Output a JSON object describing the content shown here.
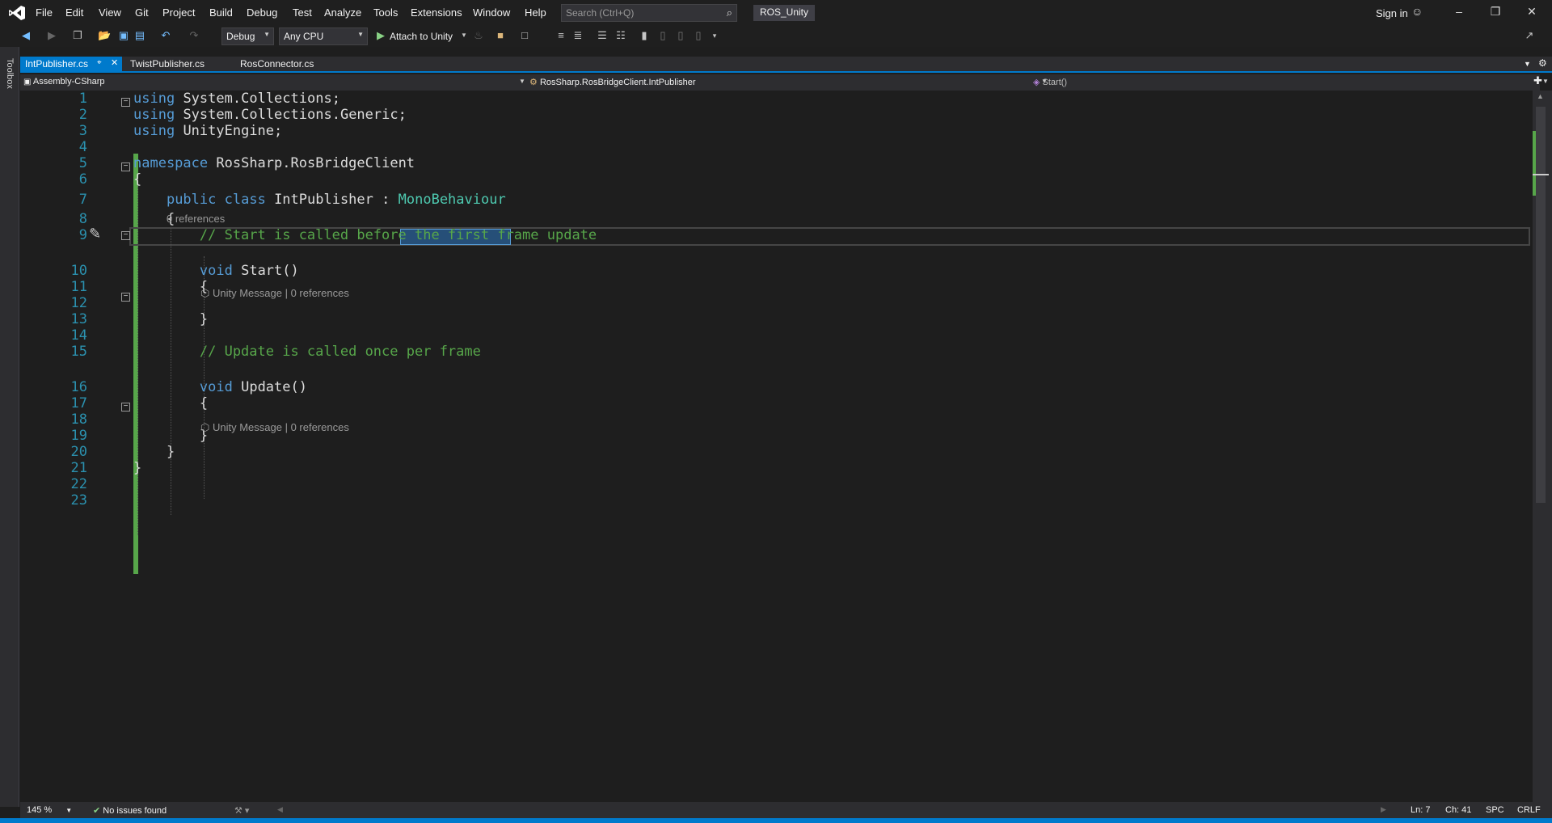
{
  "menu": [
    "File",
    "Edit",
    "View",
    "Git",
    "Project",
    "Build",
    "Debug",
    "Test",
    "Analyze",
    "Tools",
    "Extensions",
    "Window",
    "Help"
  ],
  "search": {
    "placeholder": "Search (Ctrl+Q)"
  },
  "solution_name": "ROS_Unity",
  "sign_in": "Sign in",
  "toolbar": {
    "config": "Debug",
    "platform": "Any CPU",
    "attach": "Attach to Unity"
  },
  "toolbox_label": "Toolbox",
  "tabs": [
    {
      "label": "IntPublisher.cs",
      "active": true
    },
    {
      "label": "TwistPublisher.cs",
      "active": false
    },
    {
      "label": "RosConnector.cs",
      "active": false
    }
  ],
  "navbar": {
    "project": "Assembly-CSharp",
    "type": "RosSharp.RosBridgeClient.IntPublisher",
    "member": "Start()"
  },
  "code_lines": [
    {
      "n": "1",
      "text": "using System.Collections;"
    },
    {
      "n": "2",
      "text": "using System.Collections.Generic;"
    },
    {
      "n": "3",
      "text": "using UnityEngine;"
    },
    {
      "n": "4",
      "text": ""
    },
    {
      "n": "5",
      "text": "namespace RosSharp.RosBridgeClient"
    },
    {
      "n": "6",
      "text": "{"
    },
    {
      "n": "7",
      "text": "    public class IntPublisher : MonoBehaviour"
    },
    {
      "n": "8",
      "text": "    {"
    },
    {
      "n": "9",
      "text": "        // Start is called before the first frame update"
    },
    {
      "n": "10",
      "text": "        void Start()"
    },
    {
      "n": "11",
      "text": "        {"
    },
    {
      "n": "12",
      "text": ""
    },
    {
      "n": "13",
      "text": "        }"
    },
    {
      "n": "14",
      "text": ""
    },
    {
      "n": "15",
      "text": "        // Update is called once per frame"
    },
    {
      "n": "16",
      "text": "        void Update()"
    },
    {
      "n": "17",
      "text": "        {"
    },
    {
      "n": "18",
      "text": ""
    },
    {
      "n": "19",
      "text": "        }"
    },
    {
      "n": "20",
      "text": "    }"
    },
    {
      "n": "21",
      "text": "}"
    },
    {
      "n": "22",
      "text": ""
    },
    {
      "n": "23",
      "text": ""
    }
  ],
  "codelens": {
    "class_refs": "0 references",
    "start_lens": "Unity Message | 0 references",
    "update_lens": "Unity Message | 0 references"
  },
  "status": {
    "zoom": "145 %",
    "issues": "No issues found",
    "line": "Ln: 7",
    "col": "Ch: 41",
    "whitespace": "SPC",
    "eol": "CRLF"
  }
}
